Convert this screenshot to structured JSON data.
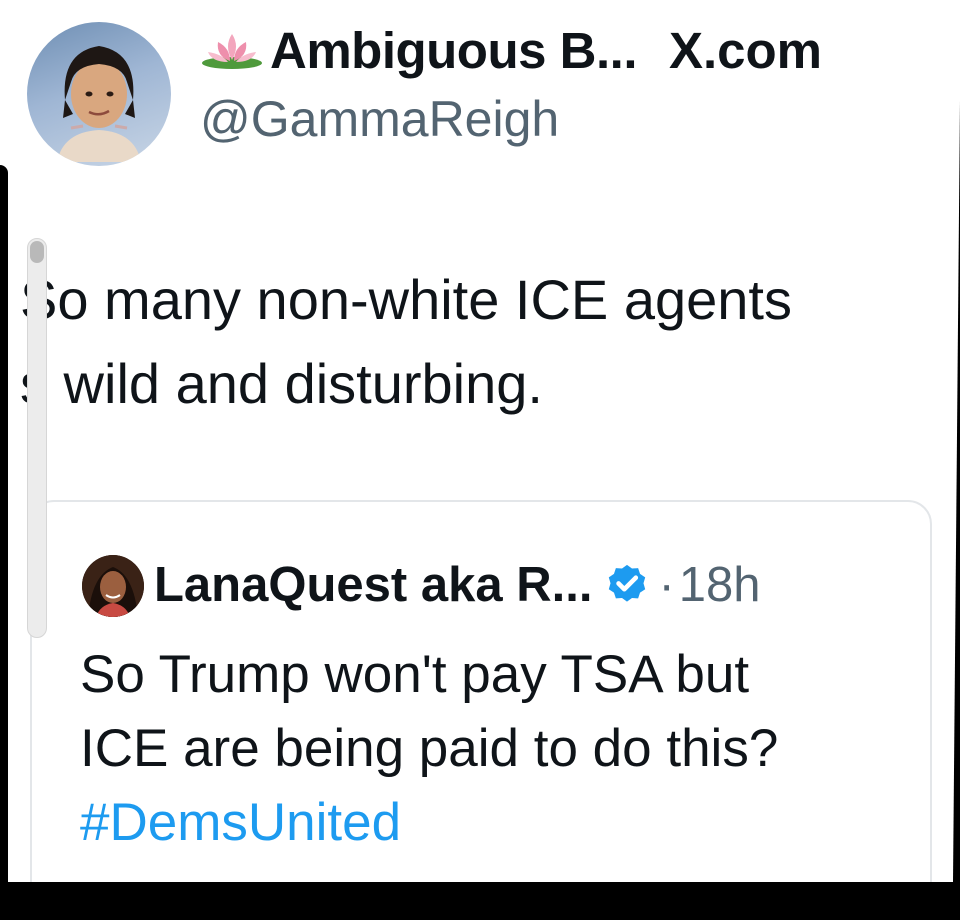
{
  "tweet": {
    "author_name": "Ambiguous B...",
    "author_emoji_icon": "lotus-icon",
    "site_label": "X.com",
    "handle": "@GammaReigh",
    "text_line1": "So many non-white ICE agents",
    "text_line2": "s wild and disturbing."
  },
  "quoted_tweet": {
    "author_name": "LanaQuest aka R...",
    "verified_icon": "verified-badge-icon",
    "separator": "·",
    "time": "18h",
    "text_line1": "So Trump won't pay TSA but",
    "text_line2": "ICE are being paid to do this?",
    "hashtag": "#DemsUnited"
  },
  "colors": {
    "text_primary": "#0f1419",
    "text_secondary": "#536471",
    "link": "#1d9bf0",
    "verified": "#1d9bf0"
  }
}
